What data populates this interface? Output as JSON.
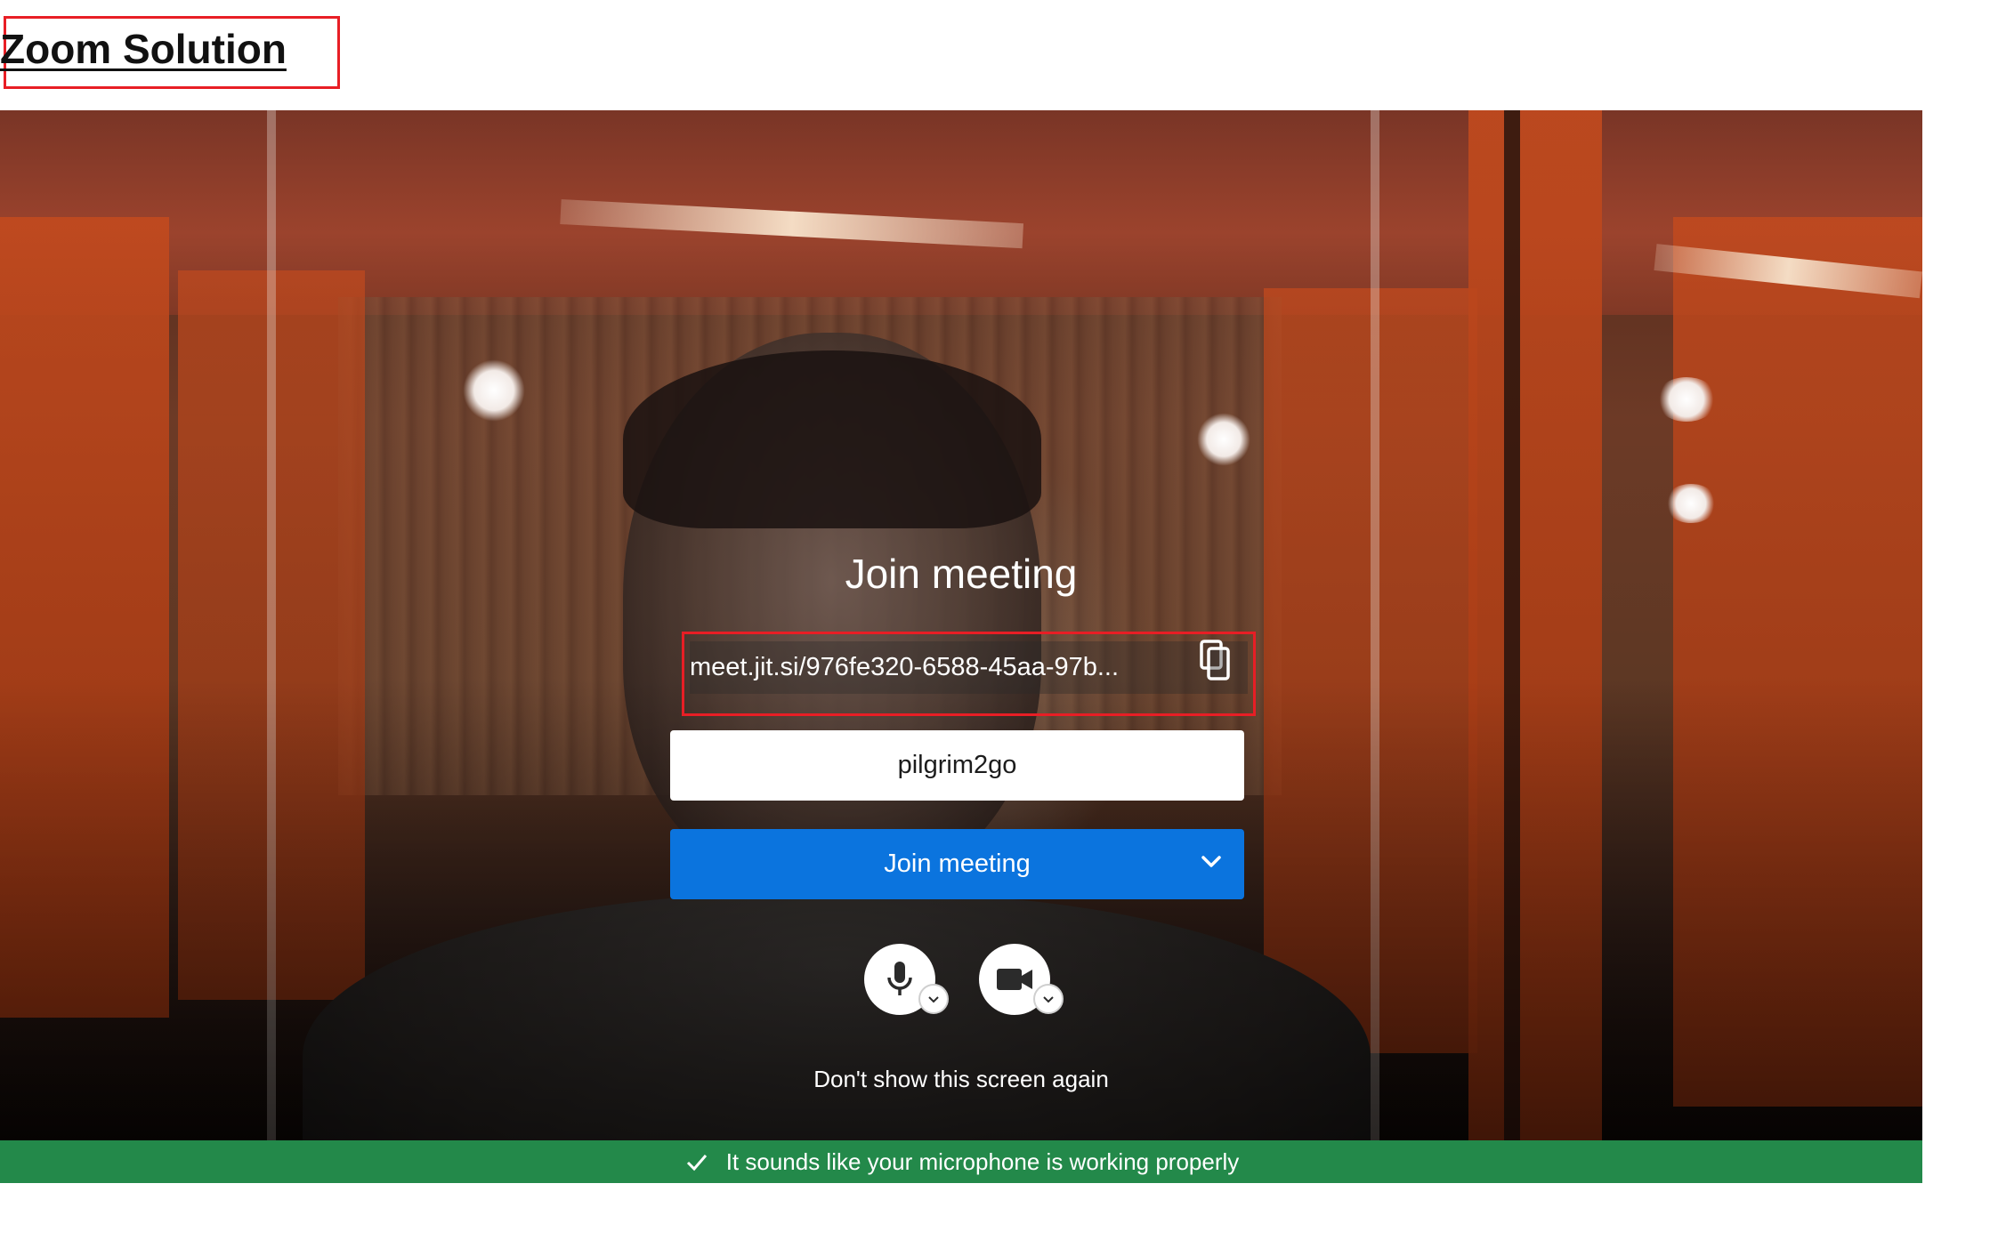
{
  "header": {
    "title": "Zoom Solution"
  },
  "prejoin": {
    "heading": "Join meeting",
    "meeting_url": "meet.jit.si/976fe320-6588-45aa-97b...",
    "name_value": "pilgrim2go",
    "join_button_label": "Join meeting",
    "dont_show_label": "Don't show this screen again"
  },
  "status": {
    "message": "It sounds like your microphone is working properly",
    "color": "#23894a"
  },
  "icons": {
    "copy": "copy-icon",
    "chevron": "chevron-down-icon",
    "mic": "microphone-icon",
    "camera": "video-camera-icon",
    "check": "check-icon"
  },
  "colors": {
    "accent": "#0b74de",
    "highlight_border": "#e81e25"
  }
}
